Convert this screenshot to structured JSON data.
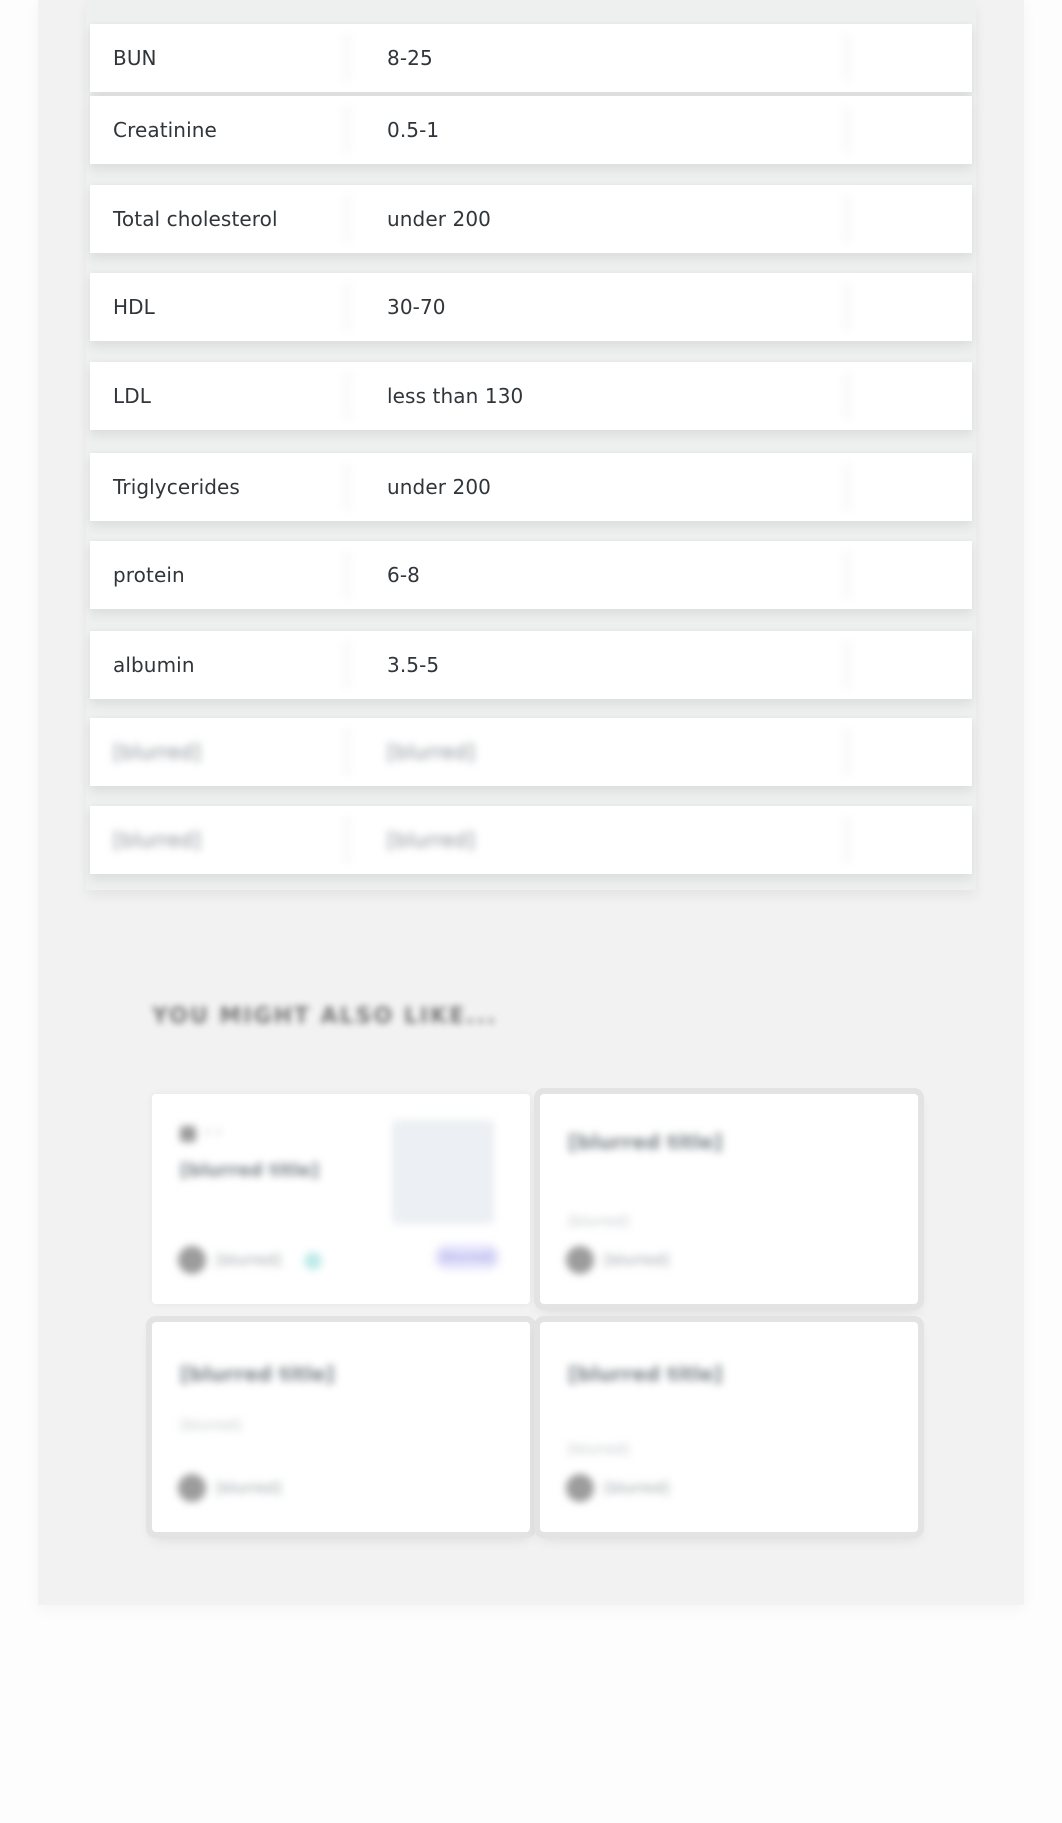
{
  "table": {
    "rows": [
      {
        "name": "BUN",
        "value": "8-25",
        "blurred": false
      },
      {
        "name": "Creatinine",
        "value": "0.5-1",
        "blurred": false
      },
      {
        "name": "Total cholesterol",
        "value": "under 200",
        "blurred": false
      },
      {
        "name": "HDL",
        "value": "30-70",
        "blurred": false
      },
      {
        "name": "LDL",
        "value": "less than 130",
        "blurred": false
      },
      {
        "name": "Triglycerides",
        "value": "under 200",
        "blurred": false
      },
      {
        "name": "protein",
        "value": "6-8",
        "blurred": false
      },
      {
        "name": "albumin",
        "value": "3.5-5",
        "blurred": false
      },
      {
        "name": "[blurred]",
        "value": "[blurred]",
        "blurred": true
      },
      {
        "name": "[blurred]",
        "value": "[blurred]",
        "blurred": true
      }
    ]
  },
  "recommendations": {
    "title": "YOU MIGHT ALSO LIKE...",
    "cards": [
      {
        "title": "[blurred title]",
        "meta": "",
        "author": "[blurred]",
        "price_label": "[blurred]",
        "has_thumbnail": true,
        "verified": true
      },
      {
        "title": "[blurred title]",
        "meta": "[blurred]",
        "author": "[blurred]"
      },
      {
        "title": "[blurred title]",
        "meta": "[blurred]",
        "author": "[blurred]"
      },
      {
        "title": "[blurred title]",
        "meta": "[blurred]",
        "author": "[blurred]"
      }
    ]
  }
}
